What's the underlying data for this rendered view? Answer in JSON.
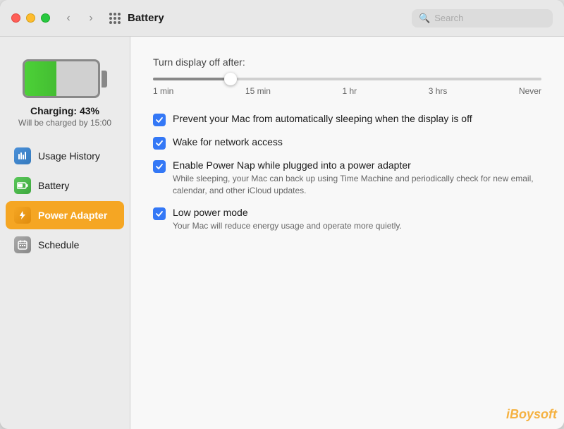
{
  "titlebar": {
    "title": "Battery",
    "search_placeholder": "Search",
    "nav_back": "‹",
    "nav_forward": "›"
  },
  "sidebar": {
    "battery_status": "Charging: 43%",
    "charge_time": "Will be charged by 15:00",
    "items": [
      {
        "id": "usage-history",
        "label": "Usage History",
        "icon": "usage"
      },
      {
        "id": "battery",
        "label": "Battery",
        "icon": "battery"
      },
      {
        "id": "power-adapter",
        "label": "Power Adapter",
        "icon": "power",
        "active": true
      },
      {
        "id": "schedule",
        "label": "Schedule",
        "icon": "schedule"
      }
    ]
  },
  "detail": {
    "slider_title": "Turn display off after:",
    "slider_ticks": [
      "1 min",
      "15 min",
      "1 hr",
      "3 hrs",
      "Never"
    ],
    "options": [
      {
        "id": "opt-sleep",
        "label": "Prevent your Mac from automatically sleeping when the display is off",
        "description": "",
        "checked": true
      },
      {
        "id": "opt-network",
        "label": "Wake for network access",
        "description": "",
        "checked": true
      },
      {
        "id": "opt-powernap",
        "label": "Enable Power Nap while plugged into a power adapter",
        "description": "While sleeping, your Mac can back up using Time Machine and periodically check for new email, calendar, and other iCloud updates.",
        "checked": true
      },
      {
        "id": "opt-lowpower",
        "label": "Low power mode",
        "description": "Your Mac will reduce energy usage and operate more quietly.",
        "checked": true
      }
    ]
  },
  "watermark": {
    "prefix": "i",
    "name": "Boysoft",
    "suffix": ""
  }
}
